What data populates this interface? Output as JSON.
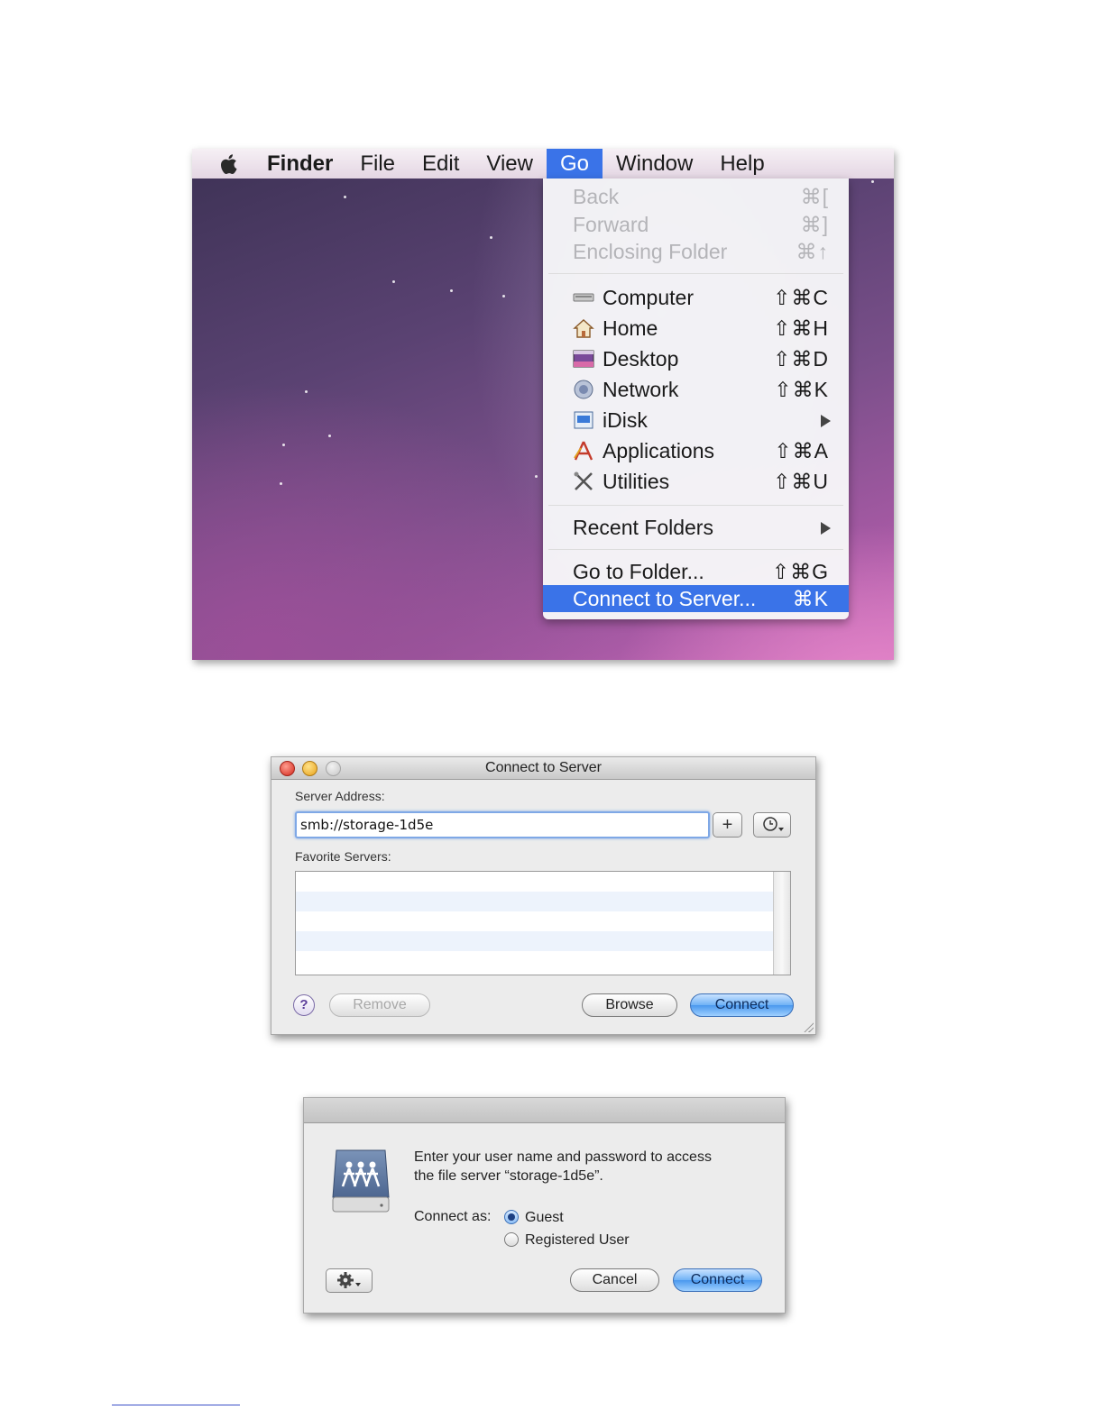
{
  "menubar": {
    "app_name": "Finder",
    "items": [
      "File",
      "Edit",
      "View",
      "Go",
      "Window",
      "Help"
    ],
    "active_item": "Go"
  },
  "go_menu": {
    "nav": [
      {
        "label": "Back",
        "shortcut": "⌘["
      },
      {
        "label": "Forward",
        "shortcut": "⌘]"
      },
      {
        "label": "Enclosing Folder",
        "shortcut": "⌘↑"
      }
    ],
    "places": [
      {
        "label": "Computer",
        "shortcut": "⇧⌘C",
        "icon": "computer-icon"
      },
      {
        "label": "Home",
        "shortcut": "⇧⌘H",
        "icon": "home-icon"
      },
      {
        "label": "Desktop",
        "shortcut": "⇧⌘D",
        "icon": "desktop-icon"
      },
      {
        "label": "Network",
        "shortcut": "⇧⌘K",
        "icon": "network-icon"
      },
      {
        "label": "iDisk",
        "shortcut": "",
        "icon": "idisk-icon"
      },
      {
        "label": "Applications",
        "shortcut": "⇧⌘A",
        "icon": "applications-icon"
      },
      {
        "label": "Utilities",
        "shortcut": "⇧⌘U",
        "icon": "utilities-icon"
      }
    ],
    "recent_folders": "Recent Folders",
    "go_to_folder": {
      "label": "Go to Folder...",
      "shortcut": "⇧⌘G"
    },
    "connect_to_server": {
      "label": "Connect to Server...",
      "shortcut": "⌘K"
    }
  },
  "connect_dialog": {
    "title": "Connect to Server",
    "server_address_label": "Server Address:",
    "server_address_value": "smb://storage-1d5e",
    "add_button": "+",
    "favorite_servers_label": "Favorite Servers:",
    "help_button": "?",
    "remove_button": "Remove",
    "browse_button": "Browse",
    "connect_button": "Connect"
  },
  "login_dialog": {
    "message_line1": "Enter your user name and password to access",
    "message_line2": "the file server “storage-1d5e”.",
    "connect_as_label": "Connect as:",
    "option_guest": "Guest",
    "option_registered": "Registered User",
    "cancel_button": "Cancel",
    "connect_button": "Connect"
  },
  "colors": {
    "menu_highlight": "#3a73e8",
    "default_button": "#4a98ee"
  }
}
